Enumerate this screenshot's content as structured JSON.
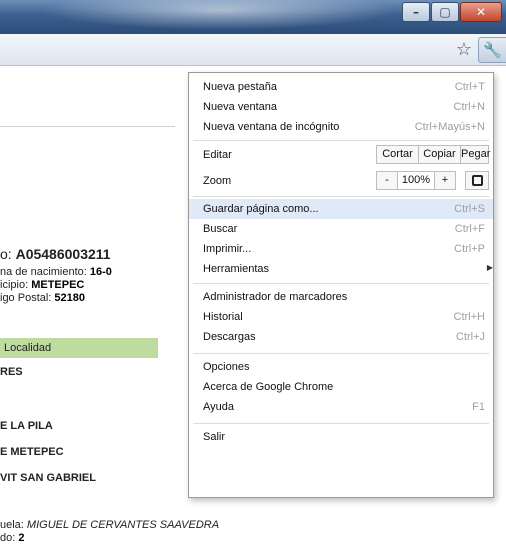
{
  "window": {
    "min_glyph": "–",
    "max_glyph": "▢",
    "close_glyph": "✕"
  },
  "toolbar": {
    "star_glyph": "☆",
    "wrench_glyph": "🔧"
  },
  "page": {
    "folio_label": "o: ",
    "folio_value": "A05486003211",
    "fecha_label": "na de nacimiento: ",
    "fecha_value": "16-0",
    "municipio_label": "icipio: ",
    "municipio_value": "METEPEC",
    "cp_label": "igo Postal: ",
    "cp_value": "52180",
    "localidad_header": "Localidad",
    "line_res": "RES",
    "line_pila": "E LA PILA",
    "line_metepec": "E METEPEC",
    "line_vit": "VIT SAN GABRIEL",
    "escuela_label": "uela: ",
    "escuela_value": "MIGUEL DE CERVANTES SAAVEDRA",
    "grado_label": "do: ",
    "grado_value": "2"
  },
  "menu": {
    "new_tab": {
      "label": "Nueva pestaña",
      "shortcut": "Ctrl+T"
    },
    "new_window": {
      "label": "Nueva ventana",
      "shortcut": "Ctrl+N"
    },
    "incognito": {
      "label": "Nueva ventana de incógnito",
      "shortcut": "Ctrl+Mayús+N"
    },
    "edit": {
      "label": "Editar",
      "cut": "Cortar",
      "copy": "Copiar",
      "paste": "Pegar"
    },
    "zoom": {
      "label": "Zoom",
      "minus": "-",
      "level": "100%",
      "plus": "+"
    },
    "save_as": {
      "label": "Guardar página como...",
      "shortcut": "Ctrl+S"
    },
    "find": {
      "label": "Buscar",
      "shortcut": "Ctrl+F"
    },
    "print": {
      "label": "Imprimir...",
      "shortcut": "Ctrl+P"
    },
    "tools": {
      "label": "Herramientas",
      "arrow": "▶"
    },
    "bookmarks": {
      "label": "Administrador de marcadores"
    },
    "history": {
      "label": "Historial",
      "shortcut": "Ctrl+H"
    },
    "downloads": {
      "label": "Descargas",
      "shortcut": "Ctrl+J"
    },
    "options": {
      "label": "Opciones"
    },
    "about": {
      "label": "Acerca de Google Chrome"
    },
    "help": {
      "label": "Ayuda",
      "shortcut": "F1"
    },
    "exit": {
      "label": "Salir"
    }
  }
}
